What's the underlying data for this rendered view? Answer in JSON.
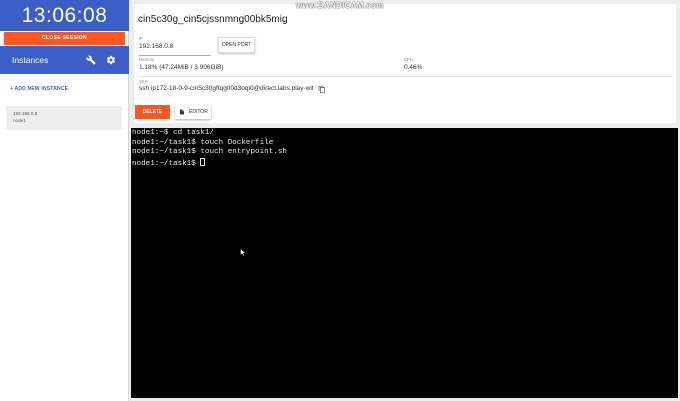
{
  "sidebar": {
    "clock": "13:06:08",
    "close_session_label": "CLOSE SESSION",
    "instances_title": "Instances",
    "add_instance_label": "+ ADD NEW INSTANCE",
    "instances": [
      {
        "ip": "192.168.0.8",
        "name": "node1"
      }
    ]
  },
  "instance_panel": {
    "title": "cin5c30g_cin5cjssnmng00bk5mig",
    "ip_label": "IP",
    "ip_value": "192.168.0.8",
    "open_port_label": "OPEN PORT",
    "memory_label": "Memory",
    "memory_value": "1.18% (47.24MiB / 3.906GiB)",
    "cpu_label": "CPU",
    "cpu_value": "0.46%",
    "ssh_label": "SSH",
    "ssh_value": "ssh ip172-18-0-9-cin5c30gftqg00d3oqi0@direct.labs.play-wit",
    "delete_label": "DELETE",
    "editor_label": "EDITOR"
  },
  "terminal": {
    "lines": [
      "node1:~$ cd task1/",
      "node1:~/task1$ touch Dockerfile",
      "node1:~/task1$ touch entrypoint.sh",
      "node1:~/task1$ "
    ]
  },
  "watermark": "www.BANDICAM.com",
  "colors": {
    "primary": "#3b5ec7",
    "accent": "#ff5722",
    "terminal_bg": "#000000"
  }
}
